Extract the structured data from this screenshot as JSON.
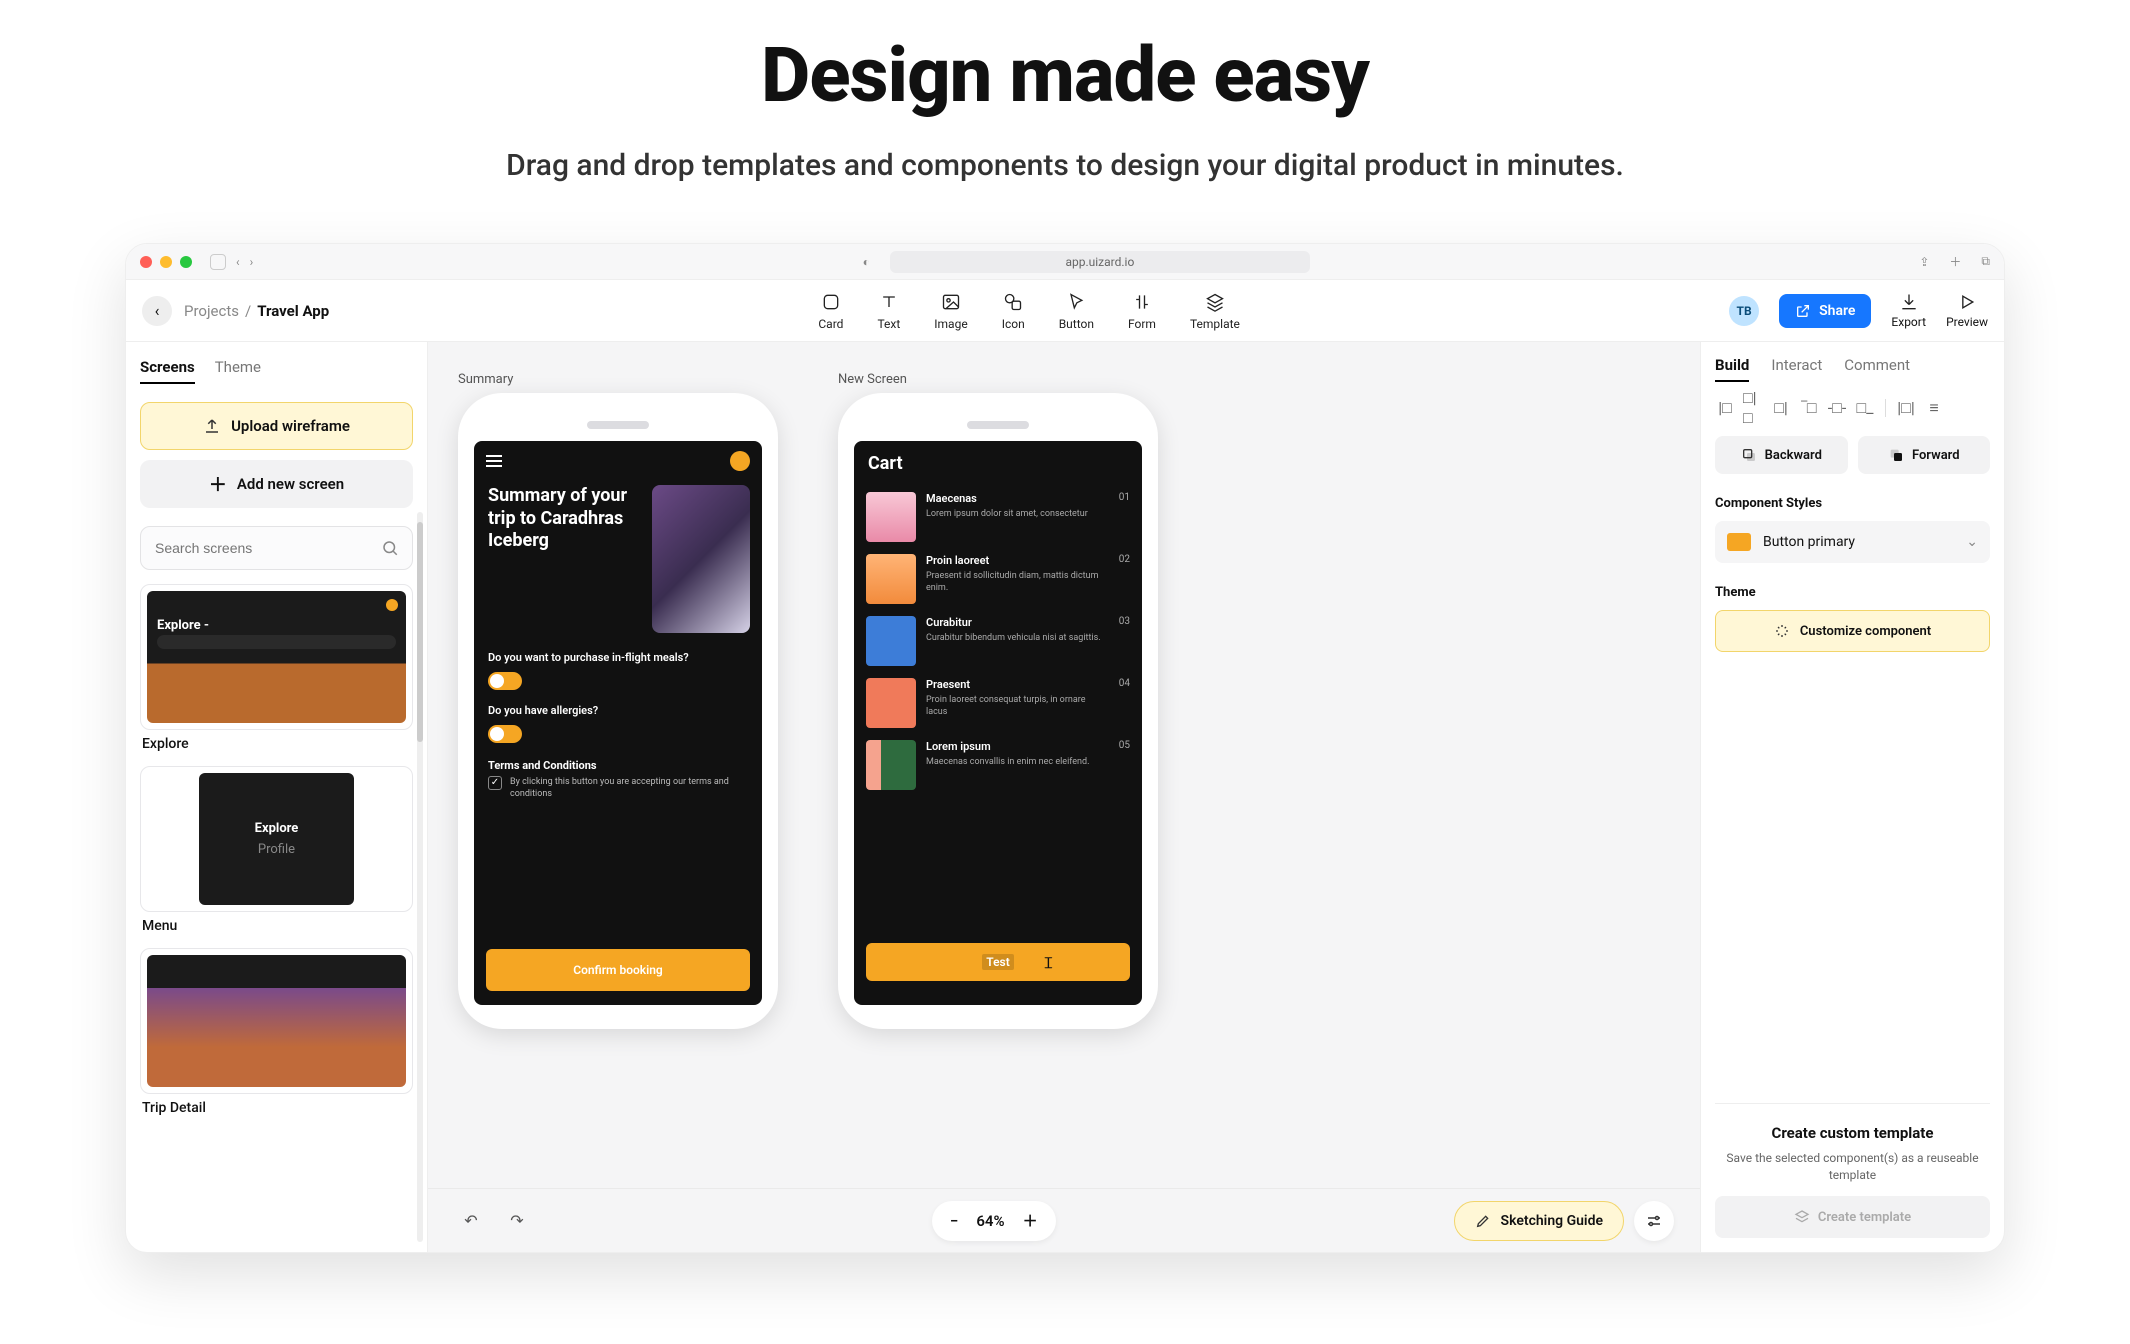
{
  "hero": {
    "title": "Design made easy",
    "subtitle": "Drag and drop templates and components to design your digital product in minutes."
  },
  "browser": {
    "url": "app.uizard.io"
  },
  "header": {
    "breadcrumb_root": "Projects",
    "breadcrumb_sep": "/",
    "breadcrumb_leaf": "Travel App",
    "tools": {
      "card": "Card",
      "text": "Text",
      "image": "Image",
      "icon": "Icon",
      "button": "Button",
      "form": "Form",
      "template": "Template"
    },
    "avatar": "TB",
    "share": "Share",
    "export": "Export",
    "preview": "Preview"
  },
  "left": {
    "tabs": {
      "screens": "Screens",
      "theme": "Theme"
    },
    "upload": "Upload wireframe",
    "addnew": "Add new screen",
    "search_placeholder": "Search screens",
    "items": {
      "explore": {
        "thumb_title": "Explore -",
        "label": "Explore"
      },
      "menu": {
        "thumb_line1": "Explore",
        "thumb_line2": "Profile",
        "label": "Menu"
      },
      "tripdetail": {
        "label": "Trip Detail"
      }
    }
  },
  "canvas": {
    "zoom": "64%",
    "sketching_guide": "Sketching Guide",
    "phone1": {
      "label": "Summary",
      "title": "Summary of your trip to Caradhras Iceberg",
      "q1": "Do you want to purchase in-flight meals?",
      "q2": "Do you have allergies?",
      "terms_h": "Terms and Conditions",
      "terms_body": "By clicking this button you are accepting our terms and conditions",
      "cta": "Confirm booking"
    },
    "phone2": {
      "label": "New Screen",
      "title": "Cart",
      "rows": [
        {
          "t": "Maecenas",
          "d": "Lorem ipsum dolor sit amet, consectetur",
          "n": "01"
        },
        {
          "t": "Proin laoreet",
          "d": "Praesent id sollicitudin diam, mattis dictum enim.",
          "n": "02"
        },
        {
          "t": "Curabitur",
          "d": "Curabitur bibendum vehicula nisi at sagittis.",
          "n": "03"
        },
        {
          "t": "Praesent",
          "d": "Proin laoreet consequat turpis, in ornare lacus",
          "n": "04"
        },
        {
          "t": "Lorem ipsum",
          "d": "Maecenas convallis in enim nec eleifend.",
          "n": "05"
        }
      ],
      "cta": "Test"
    }
  },
  "right": {
    "tabs": {
      "build": "Build",
      "interact": "Interact",
      "comment": "Comment"
    },
    "layers": {
      "backward": "Backward",
      "forward": "Forward"
    },
    "component_styles_label": "Component Styles",
    "style_name": "Button primary",
    "theme_label": "Theme",
    "customize": "Customize component",
    "template_block": {
      "title": "Create custom template",
      "body": "Save the selected component(s) as a reuseable template",
      "cta": "Create template"
    }
  }
}
